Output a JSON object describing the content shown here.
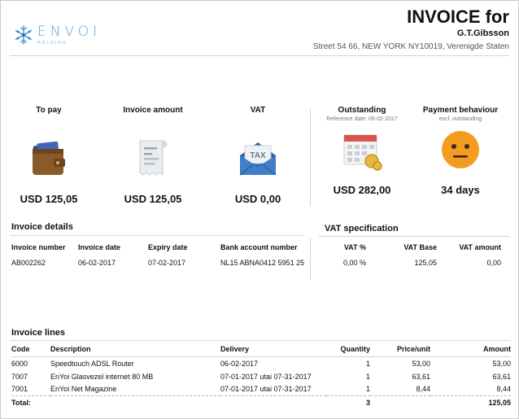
{
  "header": {
    "brand": "ENVOI",
    "tagline": "HOLDING",
    "title": "INVOICE for",
    "customer_name": "G.T.Gibsson",
    "customer_address": "Street 54 66, NEW YORK NY10019, Verenigde Staten"
  },
  "kpis": {
    "to_pay": {
      "label": "To pay",
      "value": "USD 125,05",
      "icon": "wallet-icon"
    },
    "invoice_amount": {
      "label": "Invoice amount",
      "value": "USD 125,05",
      "icon": "receipt-icon"
    },
    "vat": {
      "label": "VAT",
      "value": "USD 0,00",
      "icon": "tax-envelope-icon"
    },
    "outstanding": {
      "label": "Outstanding",
      "sub": "Reference date: 06-02-2017",
      "value": "USD 282,00",
      "icon": "calendar-coins-icon"
    },
    "payment_behaviour": {
      "label": "Payment behaviour",
      "sub": "excl. outstanding",
      "value": "34 days",
      "icon": "neutral-face-icon"
    }
  },
  "invoice_details": {
    "title": "Invoice details",
    "headers": {
      "number": "Invoice number",
      "date": "Invoice date",
      "expiry": "Expiry date",
      "bank": "Bank account number"
    },
    "values": {
      "number": "AB002262",
      "date": "06-02-2017",
      "expiry": "07-02-2017",
      "bank": "NL15 ABNA0412 5951 25"
    }
  },
  "vat_spec": {
    "title": "VAT specification",
    "headers": {
      "pct": "VAT %",
      "base": "VAT Base",
      "amount": "VAT amount"
    },
    "values": {
      "pct": "0,00 %",
      "base": "125,05",
      "amount": "0,00"
    }
  },
  "invoice_lines": {
    "title": "Invoice lines",
    "headers": {
      "code": "Code",
      "description": "Description",
      "delivery": "Delivery",
      "quantity": "Quantity",
      "price": "Price/unit",
      "amount": "Amount"
    },
    "rows": [
      {
        "code": "6000",
        "description": "Speedtouch ADSL Router",
        "delivery": "06-02-2017",
        "quantity": "1",
        "price": "53,00",
        "amount": "53,00"
      },
      {
        "code": "7007",
        "description": "EnYoi Glasvezel internet 80 MB",
        "delivery": "07-01-2017 utai 07-31-2017",
        "quantity": "1",
        "price": "63,61",
        "amount": "63,61"
      },
      {
        "code": "7001",
        "description": "EnYoi Net Magazine",
        "delivery": "07-01-2017 utai 07-31-2017",
        "quantity": "1",
        "price": "8,44",
        "amount": "8,44"
      }
    ],
    "total": {
      "label": "Total:",
      "quantity": "3",
      "amount": "125,05"
    }
  },
  "colors": {
    "brand_blue": "#5aa4d6",
    "envelope_blue": "#3f7fc4",
    "face_orange": "#f39c1f",
    "wallet_brown": "#8b5a2b"
  }
}
